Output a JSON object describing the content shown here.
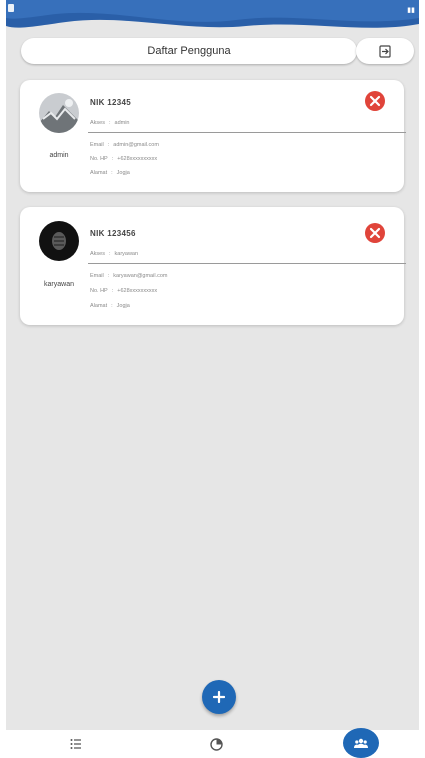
{
  "header": {
    "title": "Daftar Pengguna",
    "export_icon": "file-export-icon"
  },
  "users": [
    {
      "username": "admin",
      "nik": "NIK  12345",
      "access_label": "Akses",
      "access_value": "admin",
      "email_label": "Email",
      "email_value": "admin@gmail.com",
      "phone_label": "No. HP",
      "phone_value": "+628xxxxxxxxxx",
      "address_label": "Alamat",
      "address_value": "Jogja"
    },
    {
      "username": "karyawan",
      "nik": "NIK  123456",
      "access_label": "Akses",
      "access_value": "karyawan",
      "email_label": "Email",
      "email_value": "karyawan@gmail.com",
      "phone_label": "No. HP",
      "phone_value": "+628xxxxxxxxxx",
      "address_label": "Alamat",
      "address_value": "Jogja"
    }
  ],
  "fab": {
    "icon": "plus-icon"
  },
  "bottom_nav": {
    "items": [
      {
        "icon": "list-icon",
        "active": false
      },
      {
        "icon": "chart-pie-icon",
        "active": false
      },
      {
        "icon": "users-icon",
        "active": true
      }
    ]
  },
  "colors": {
    "primary": "#1f68b6",
    "delete": "#e0443a",
    "background": "#e6e6e6",
    "card": "#ffffff"
  }
}
